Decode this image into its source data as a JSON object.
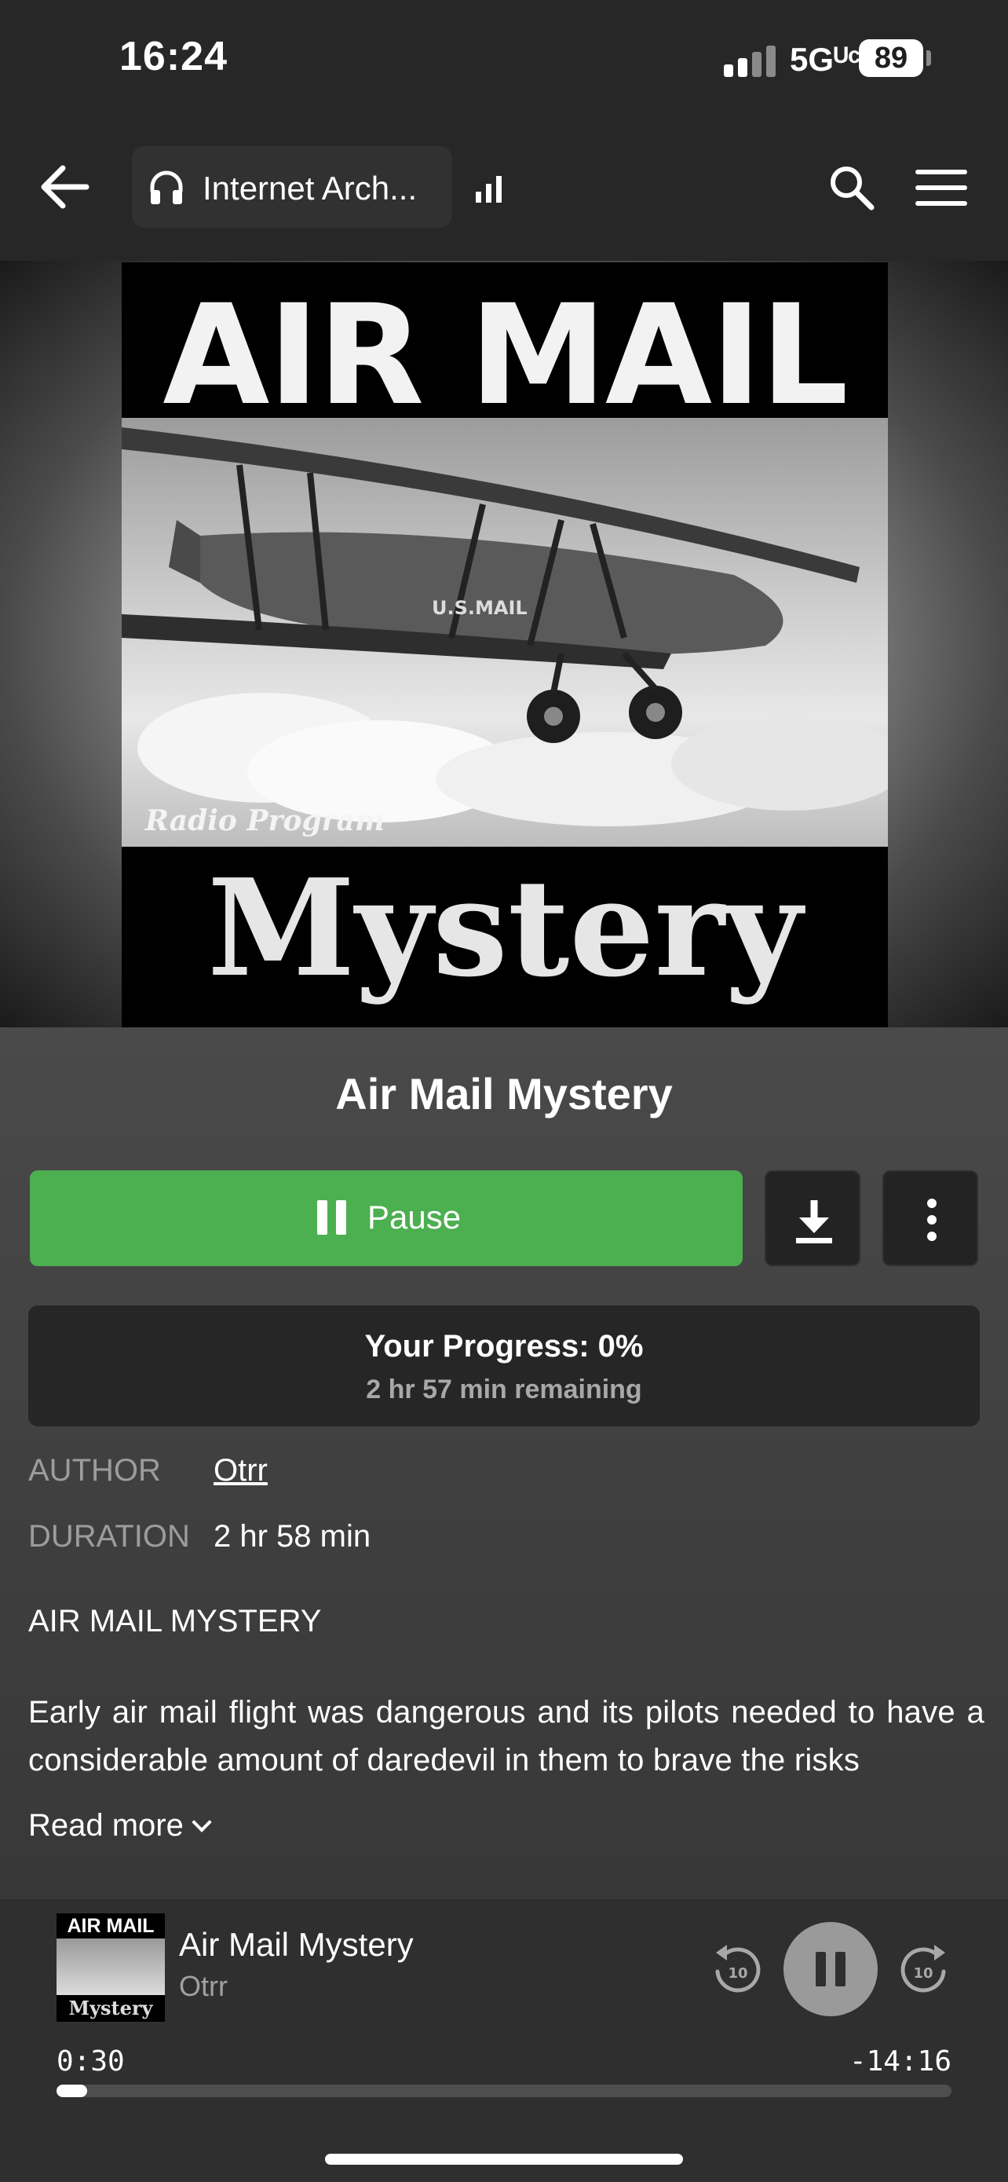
{
  "status_bar": {
    "time": "16:24",
    "network": "5Gᵁᶜ",
    "battery": "89"
  },
  "header": {
    "source_label": "Internet Arch..."
  },
  "cover": {
    "top_title": "AIR MAIL",
    "radio_label": "Radio Program",
    "bottom_title": "Mystery",
    "plane_marking": "U.S.MAIL"
  },
  "book": {
    "title": "Air Mail Mystery"
  },
  "actions": {
    "pause_label": "Pause"
  },
  "progress": {
    "title": "Your Progress: 0%",
    "subtitle": "2 hr 57 min remaining",
    "percent": 0
  },
  "meta": {
    "author_key": "AUTHOR",
    "author_value": "Otrr",
    "duration_key": "DURATION",
    "duration_value": "2 hr 58 min"
  },
  "description": {
    "heading": "AIR MAIL MYSTERY",
    "body": "Early air mail flight was dangerous and its pilots needed to have a considerable amount of daredevil in them to brave the risks",
    "read_more": "Read more"
  },
  "mini_player": {
    "title": "Air Mail Mystery",
    "author": "Otrr",
    "thumb_top": "AIR MAIL",
    "thumb_bottom": "Mystery",
    "elapsed": "0:30",
    "remaining": "-14:16",
    "progress_fraction": 0.034,
    "skip_seconds": "10"
  },
  "colors": {
    "accent": "#4caf50",
    "background": "#3a3a3a",
    "header": "#272727"
  }
}
